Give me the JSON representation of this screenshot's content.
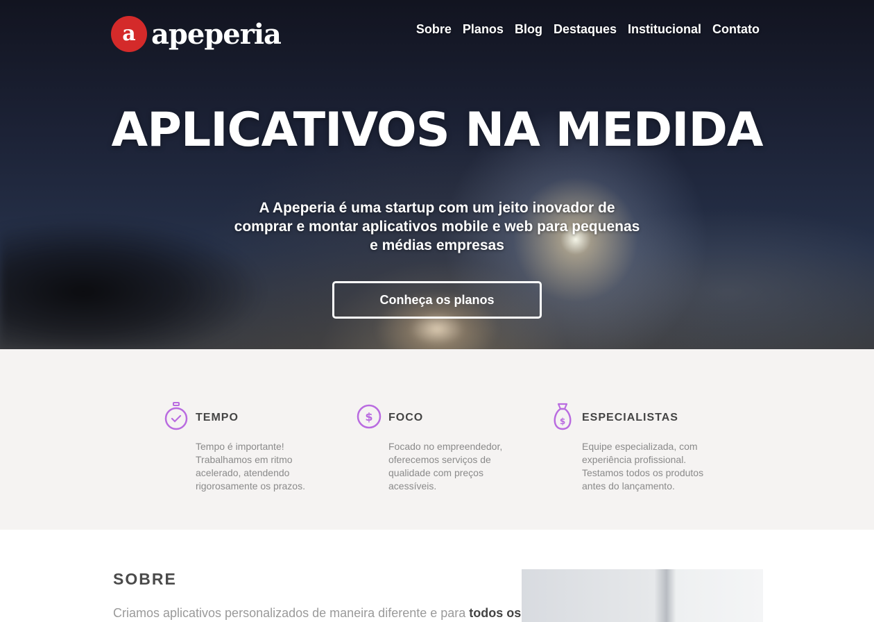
{
  "brand": {
    "logo_letter": "a",
    "name": "apeperia"
  },
  "nav": {
    "items": [
      {
        "label": "Sobre"
      },
      {
        "label": "Planos"
      },
      {
        "label": "Blog"
      },
      {
        "label": "Destaques"
      },
      {
        "label": "Institucional"
      },
      {
        "label": "Contato"
      }
    ]
  },
  "hero": {
    "title": "APLICATIVOS NA MEDIDA",
    "text": "A Apeperia é uma startup com um jeito inovador de comprar e montar aplicativos mobile e web para pequenas e médias empresas",
    "button_label": "Conheça os planos"
  },
  "features": [
    {
      "icon": "stopwatch-icon",
      "title": "TEMPO",
      "text": "Tempo é importante! Trabalhamos em ritmo acelerado, atendendo rigorosamente os prazos."
    },
    {
      "icon": "coin-icon",
      "title": "FOCO",
      "text": "Focado no empreendedor, oferecemos serviços de qualidade com preços acessíveis."
    },
    {
      "icon": "money-bag-icon",
      "title": "ESPECIALISTAS",
      "text": "Equipe especializada, com experiência profissional. Testamos todos os produtos antes do lançamento."
    }
  ],
  "about": {
    "title": "SOBRE",
    "text_prefix": "Criamos aplicativos personalizados de maneira diferente e para ",
    "text_bold": "todos os"
  },
  "colors": {
    "brand_red": "#d42a2a",
    "icon_purple": "#b96be0",
    "features_bg": "#f5f3f2"
  }
}
